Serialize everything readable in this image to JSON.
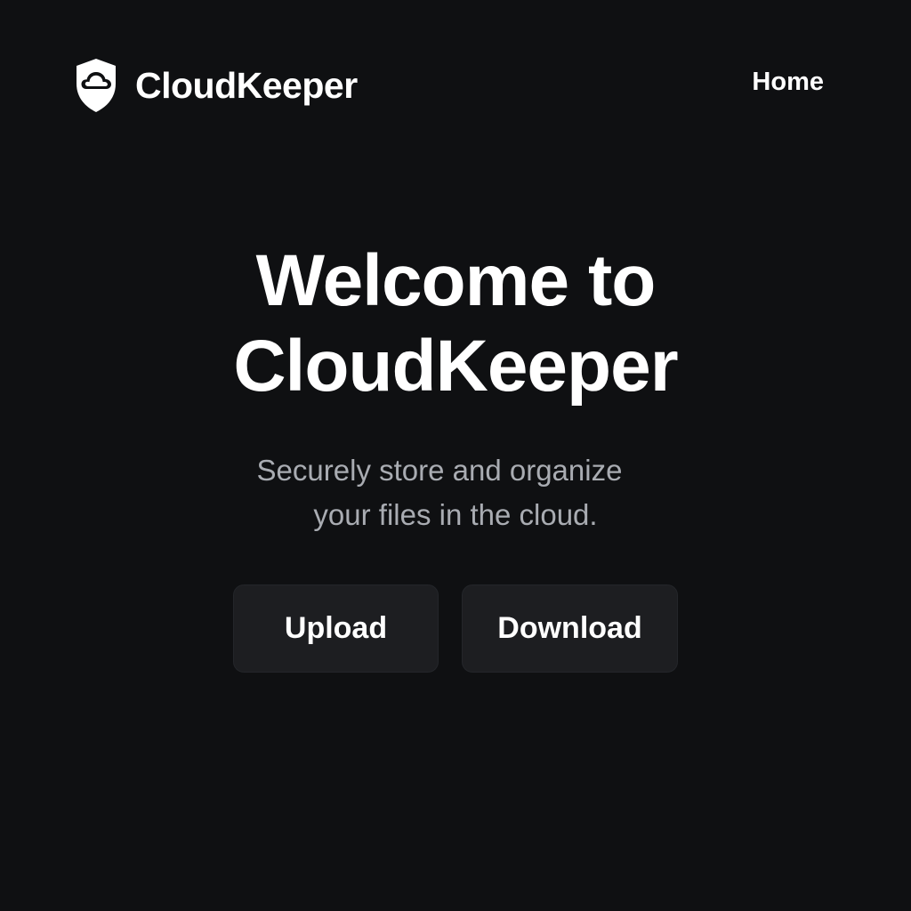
{
  "header": {
    "brand_name": "CloudKeeper",
    "logo_icon": "shield-cloud-icon",
    "nav": {
      "home_label": "Home"
    }
  },
  "hero": {
    "title_line_1": "Welcome to",
    "title_line_2": "CloudKeeper",
    "subtitle_line_1": "Securely store and organize",
    "subtitle_line_2": "your files in the cloud."
  },
  "actions": {
    "upload_label": "Upload",
    "download_label": "Download"
  },
  "colors": {
    "background": "#0f1012",
    "text_primary": "#ffffff",
    "text_secondary": "#a9acb2",
    "button_background": "#1d1e21"
  }
}
